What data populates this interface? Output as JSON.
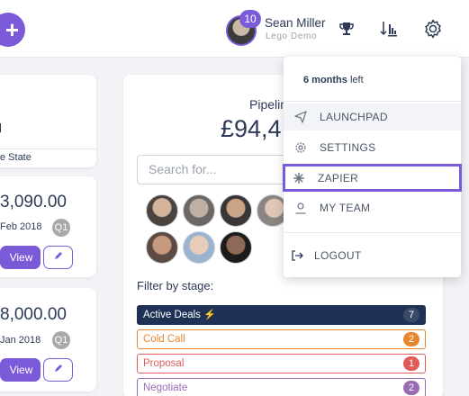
{
  "header": {
    "add_label": "+",
    "notification_count": "10",
    "user_name": "Sean Miller",
    "user_org": "Lego Demo",
    "icons": [
      "trophy-icon",
      "sort-icon",
      "gear-icon"
    ]
  },
  "left_cards": {
    "state_text": "e State",
    "items": [
      {
        "amount": "3,090.00",
        "date": "Feb 2018",
        "quarter": "Q1",
        "view_label": "View"
      },
      {
        "amount": "8,000.00",
        "date": "Jan 2018",
        "quarter": "Q1",
        "view_label": "View"
      }
    ]
  },
  "pipeline": {
    "title": "Pipelin",
    "amount": "£94,4",
    "search_placeholder": "Search for..."
  },
  "filter": {
    "label": "Filter by stage:",
    "stages": [
      {
        "name": "Active Deals",
        "count": "7",
        "color": "#1f3154"
      },
      {
        "name": "Cold Call",
        "count": "2",
        "color": "#e8852f"
      },
      {
        "name": "Proposal",
        "count": "1",
        "color": "#e15b5b"
      },
      {
        "name": "Negotiate",
        "count": "2",
        "color": "#9a6bb5"
      }
    ]
  },
  "menu": {
    "months_strong": "6 months",
    "months_rest": " left",
    "items": [
      {
        "label": "LAUNCHPAD",
        "icon": "paper-plane-icon"
      },
      {
        "label": "SETTINGS",
        "icon": "gear-icon"
      },
      {
        "label": "ZAPIER",
        "icon": "asterisk-icon"
      },
      {
        "label": "MY TEAM",
        "icon": "user-icon"
      },
      {
        "label": "LOGOUT",
        "icon": "logout-icon"
      }
    ]
  },
  "colors": {
    "accent": "#7b5ad9",
    "navy": "#1f3154",
    "text": "#2c3a57"
  }
}
